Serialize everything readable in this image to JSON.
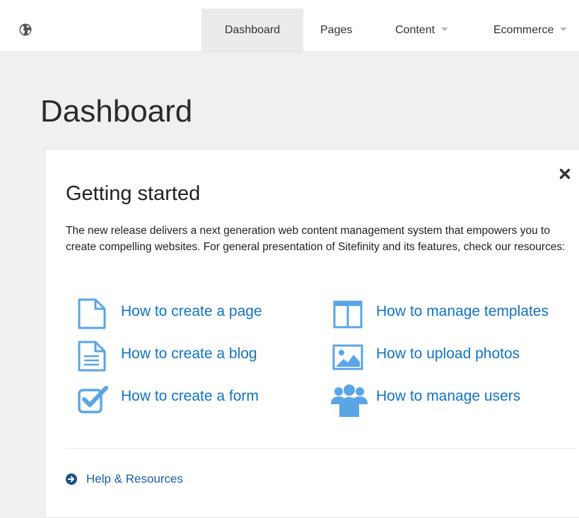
{
  "nav": {
    "logo_icon": "globe-icon",
    "items": [
      {
        "label": "Dashboard",
        "active": true,
        "dropdown": false
      },
      {
        "label": "Pages",
        "active": false,
        "dropdown": false
      },
      {
        "label": "Content",
        "active": false,
        "dropdown": true
      },
      {
        "label": "Ecommerce",
        "active": false,
        "dropdown": true
      }
    ]
  },
  "page": {
    "title": "Dashboard"
  },
  "card": {
    "title": "Getting started",
    "close_icon": "close-icon",
    "intro": "The new release delivers a next generation web content management system that empowers you to create compelling websites. For general presentation of Sitefinity and its features, check our resources:",
    "resources": [
      {
        "label": "How to create a page",
        "icon": "page-icon"
      },
      {
        "label": "How to create a blog",
        "icon": "blog-icon"
      },
      {
        "label": "How to create a form",
        "icon": "form-icon"
      },
      {
        "label": "How to manage templates",
        "icon": "templates-icon"
      },
      {
        "label": "How to upload photos",
        "icon": "photos-icon"
      },
      {
        "label": "How to manage users",
        "icon": "users-icon"
      }
    ],
    "help": {
      "label": "Help & Resources",
      "icon": "arrow-circle-right-icon"
    }
  },
  "colors": {
    "link": "#1173c7",
    "icon": "#5aa5e6",
    "nav_active_bg": "#ebebeb",
    "page_bg": "#f0f0f0"
  }
}
